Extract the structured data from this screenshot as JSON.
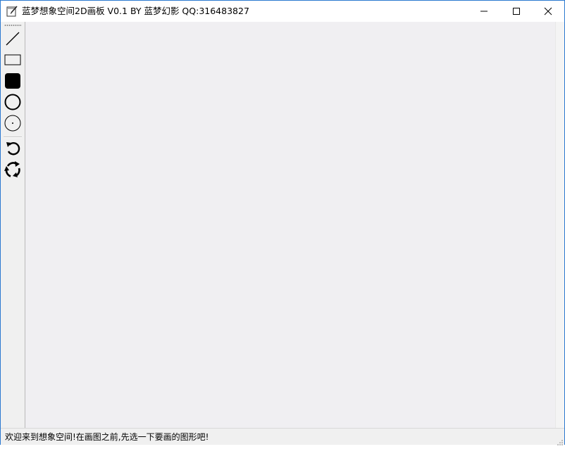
{
  "window": {
    "title": "蓝梦想象空间2D画板 V0.1 BY 蓝梦幻影 QQ:316483827",
    "app_icon": "notepad-pen-icon",
    "controls": {
      "minimize": "minimize-icon",
      "maximize": "maximize-icon",
      "close": "close-icon"
    }
  },
  "toolbar": {
    "tools": [
      {
        "id": "line",
        "icon": "line-icon"
      },
      {
        "id": "rectangle",
        "icon": "rectangle-icon"
      },
      {
        "id": "filled-rounded-rect",
        "icon": "filled-rounded-rect-icon"
      },
      {
        "id": "ellipse",
        "icon": "circle-icon"
      },
      {
        "id": "circle-center",
        "icon": "circle-center-icon"
      },
      {
        "id": "undo",
        "icon": "undo-icon"
      },
      {
        "id": "refresh",
        "icon": "refresh-icon"
      }
    ]
  },
  "status": {
    "text": "欢迎来到想象空间!在画图之前,先选一下要画的图形吧!"
  },
  "colors": {
    "canvas_bg": "#f0eff2",
    "window_border": "#2b79d0"
  }
}
